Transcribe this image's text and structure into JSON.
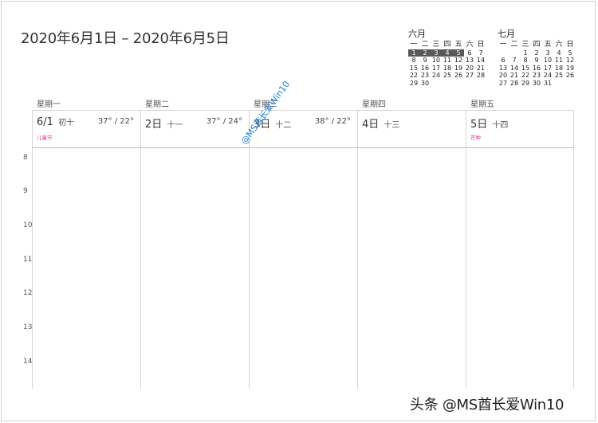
{
  "title": "2020年6月1日 – 2020年6月5日",
  "mini_calendars": [
    {
      "month": "六月",
      "weekdays": [
        "一",
        "二",
        "三",
        "四",
        "五",
        "六",
        "日"
      ],
      "weeks": [
        [
          "1",
          "2",
          "3",
          "4",
          "5",
          "6",
          "7"
        ],
        [
          "8",
          "9",
          "10",
          "11",
          "12",
          "13",
          "14"
        ],
        [
          "15",
          "16",
          "17",
          "18",
          "19",
          "20",
          "21"
        ],
        [
          "22",
          "23",
          "24",
          "25",
          "26",
          "27",
          "28"
        ],
        [
          "29",
          "30",
          "",
          "",
          "",
          "",
          ""
        ]
      ]
    },
    {
      "month": "七月",
      "weekdays": [
        "一",
        "二",
        "三",
        "四",
        "五",
        "六",
        "日"
      ],
      "weeks": [
        [
          "",
          "",
          "1",
          "2",
          "3",
          "4",
          "5"
        ],
        [
          "6",
          "7",
          "8",
          "9",
          "10",
          "11",
          "12"
        ],
        [
          "13",
          "14",
          "15",
          "16",
          "17",
          "18",
          "19"
        ],
        [
          "20",
          "21",
          "22",
          "23",
          "24",
          "25",
          "26"
        ],
        [
          "27",
          "28",
          "29",
          "30",
          "31",
          "",
          ""
        ]
      ]
    }
  ],
  "days": [
    {
      "weekday": "星期一",
      "date": "6/1",
      "lunar": "初十",
      "temp": "37° / 22°",
      "festival": "儿童节"
    },
    {
      "weekday": "星期二",
      "date": "2日",
      "lunar": "十一",
      "temp": "37° / 24°",
      "festival": ""
    },
    {
      "weekday": "星期三",
      "date": "3日",
      "lunar": "十二",
      "temp": "38° / 22°",
      "festival": ""
    },
    {
      "weekday": "星期四",
      "date": "4日",
      "lunar": "十三",
      "temp": "",
      "festival": ""
    },
    {
      "weekday": "星期五",
      "date": "5日",
      "lunar": "十四",
      "temp": "",
      "festival": "芒种"
    }
  ],
  "hours": [
    "8",
    "9",
    "10",
    "11",
    "12",
    "13",
    "14"
  ],
  "watermark": "@MS酋长爱Win10",
  "brand": "头条 @MS酋长爱Win10"
}
